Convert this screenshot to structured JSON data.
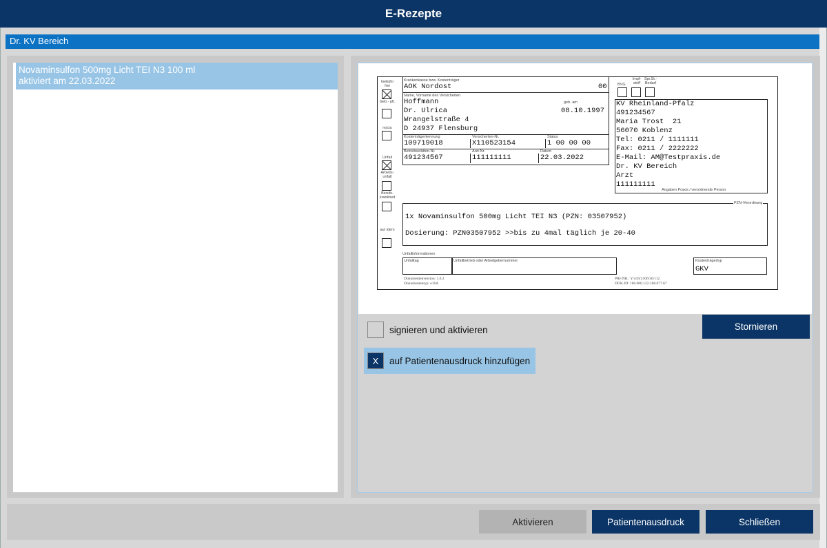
{
  "window": {
    "title": "E-Rezepte"
  },
  "section": {
    "header": "Dr. KV Bereich"
  },
  "list": {
    "items": [
      {
        "line1": "Novaminsulfon 500mg Licht TEI N3 100 ml",
        "line2": "aktiviert am 22.03.2022"
      }
    ]
  },
  "rx": {
    "labels": {
      "gebuehr_frei": "Gebühr frei",
      "geb_pfl": "Geb.- pfl.",
      "noctu": "noctu",
      "unfall": "Unfall",
      "arbeitsunfall": "Arbeits- unfall",
      "berufskrankheit": "Berufs- krankheit",
      "aut_idem": "aut idem",
      "krankenkasse": "Krankenkasse bzw. Kostenträger",
      "name": "Name, Vorname des Versicherten",
      "geb_am": "geb. am",
      "kostentraegerkennung": "Kostenträgerkennung",
      "versicherten_nr": "Versicherten-Nr.",
      "status": "Status",
      "betriebsstaetten_nr": "Betriebsstätten-Nr.",
      "arzt_nr": "Arzt-Nr.",
      "datum": "Datum",
      "bvg": "BVG",
      "impfstoff": "Impf- stoff",
      "spr_st_bedarf": "Spr.St.- Bedarf",
      "angaben_praxis": "Angaben Praxis / verordnende Person",
      "pzn_verordnung": "PZN-Verordnung",
      "unfallinformationen": "Unfallinformationen",
      "unfalltag": "Unfalltag",
      "unfallbetrieb": "Unfallbetrieb oder Arbeitgebernummer",
      "kostentraegertyp": "Kostenträgertyp",
      "dokumentenversion": "Dokumentenversion: 1.0.2",
      "dokumententyp": "Dokumententyp: e16A",
      "prf_nr": "PRF.NR.: Y/410/2106/36/112",
      "dok_id": "DOK.ID: 160.000.122.168.677.67"
    },
    "values": {
      "kasse": "AOK Nordost",
      "kasse_code": "00",
      "nachname": "Hoffmann",
      "vorname": "Dr. Ulrica",
      "geburtsdatum": "08.10.1997",
      "strasse": "Wrangelstraße 4",
      "ort": "D 24937 Flensburg",
      "kostentraegerkennung": "109719018",
      "versicherten_nr": "X110523154",
      "status": "1 00 00 00",
      "betriebsstaetten_nr": "491234567",
      "arzt_nr": "111111111",
      "datum": "22.03.2022",
      "praxis": [
        "KV Rheinland-Pfalz",
        "491234567",
        "Maria Trost  21",
        "56070 Koblenz",
        "Tel: 0211 / 1111111",
        "Fax: 0211 / 2222222",
        "E-Mail: AM@Testpraxis.de",
        "Dr. KV Bereich",
        "Arzt",
        "111111111"
      ],
      "verordnung": "1x Novaminsulfon 500mg Licht TEI N3 (PZN: 03507952)",
      "dosierung": "Dosierung: PZN03507952 >>bis zu 4mal täglich je 20-40",
      "kostentraegertyp": "GKV"
    }
  },
  "controls": {
    "sign_label": "signieren und aktivieren",
    "print_label": "auf Patientenausdruck hinzufügen",
    "print_check_mark": "X",
    "stornieren": "Stornieren",
    "aktivieren": "Aktivieren",
    "patientenausdruck": "Patientenausdruck",
    "schliessen": "Schließen"
  }
}
